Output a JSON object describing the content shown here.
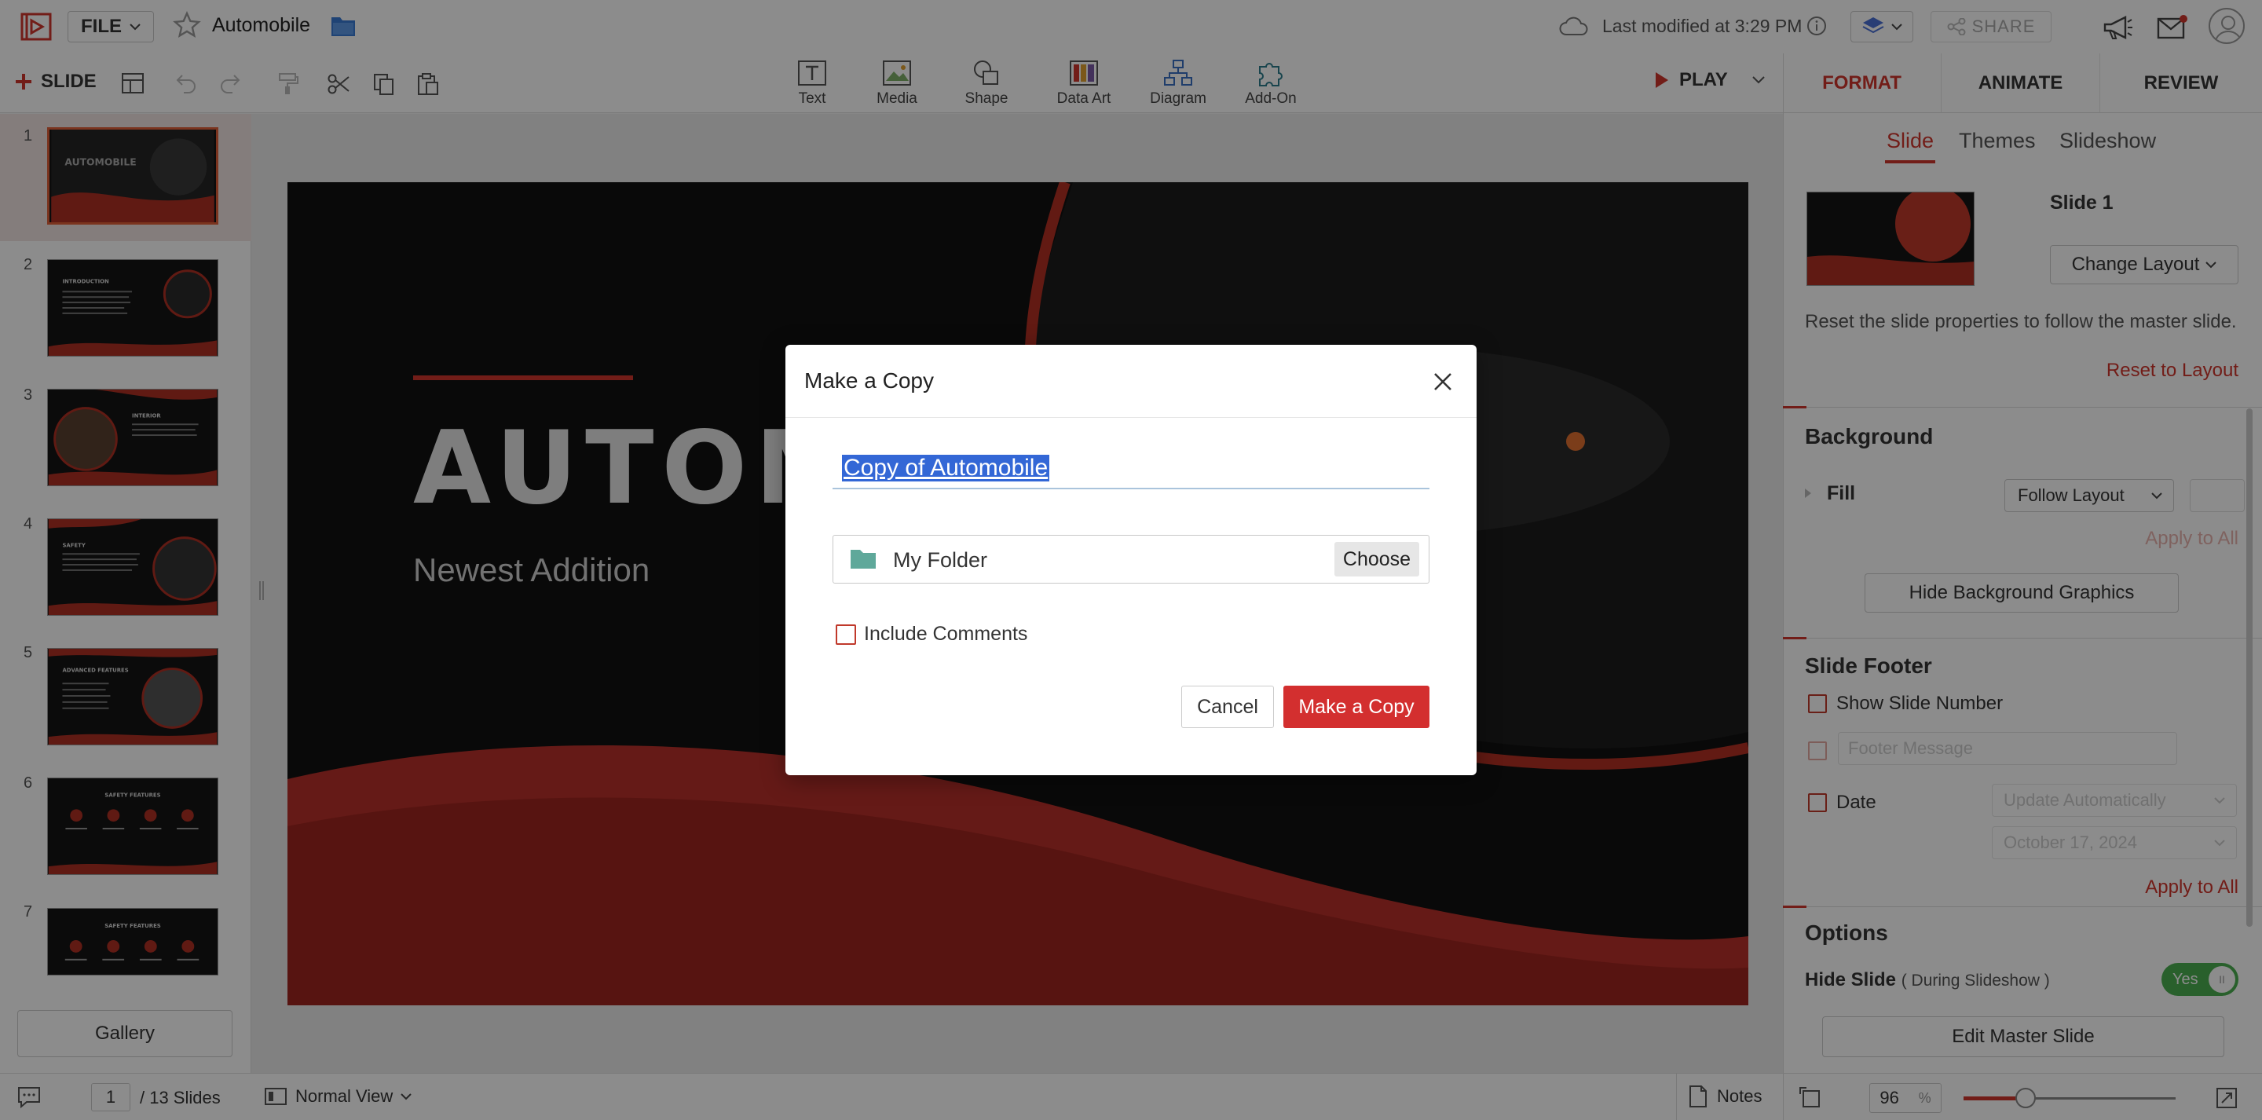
{
  "topbar": {
    "file_label": "FILE",
    "doc_title": "Automobile",
    "last_modified": "Last modified at 3:29 PM",
    "share_label": "SHARE"
  },
  "toolbar": {
    "add_slide_label": "SLIDE",
    "insert_tools": [
      "Text",
      "Media",
      "Shape",
      "Data Art",
      "Diagram",
      "Add-On"
    ],
    "play_label": "PLAY"
  },
  "right_panel": {
    "tabs": [
      "FORMAT",
      "ANIMATE",
      "REVIEW"
    ],
    "active_tab": "FORMAT",
    "subtabs": [
      "Slide",
      "Themes",
      "Slideshow"
    ],
    "active_subtab": "Slide",
    "slide_label": "Slide 1",
    "change_layout": "Change Layout",
    "reset_desc": "Reset the slide properties to follow the master slide.",
    "reset_link": "Reset to Layout",
    "background_title": "Background",
    "fill_label": "Fill",
    "fill_value": "Follow Layout",
    "apply_to_all": "Apply to All",
    "hide_bg_graphics": "Hide Background Graphics",
    "footer_title": "Slide Footer",
    "show_slide_number": "Show Slide Number",
    "footer_message_placeholder": "Footer Message",
    "date_label": "Date",
    "date_mode": "Update Automatically",
    "date_value": "October 17, 2024",
    "options_title": "Options",
    "hide_slide_label": "Hide Slide",
    "hide_slide_note": "( During Slideshow )",
    "toggle_label": "Yes",
    "edit_master": "Edit Master Slide"
  },
  "slides_panel": {
    "numbers": [
      "1",
      "2",
      "3",
      "4",
      "5",
      "6",
      "7"
    ],
    "thumb_titles": [
      "AUTOMOBILE",
      "INTRODUCTION",
      "INTERIOR",
      "SAFETY",
      "ADVANCED FEATURES",
      "SAFETY FEATURES",
      "SAFETY FEATURES"
    ],
    "gallery_label": "Gallery"
  },
  "slide": {
    "title": "AUTOMOBILE",
    "subtitle": "Newest Addition"
  },
  "statusbar": {
    "page": "1",
    "slides_count": "/ 13 Slides",
    "view_mode": "Normal View",
    "notes_label": "Notes",
    "zoom": "96",
    "zoom_unit": "%"
  },
  "dialog": {
    "title": "Make a Copy",
    "name_value": "Copy of Automobile",
    "folder_name": "My Folder",
    "choose_label": "Choose",
    "include_comments_label": "Include Comments",
    "cancel_label": "Cancel",
    "confirm_label": "Make a Copy"
  },
  "colors": {
    "accent": "#d0352c",
    "primary_button": "#d32f2f",
    "selection": "#3367d6",
    "toggle_on": "#4caf50"
  }
}
